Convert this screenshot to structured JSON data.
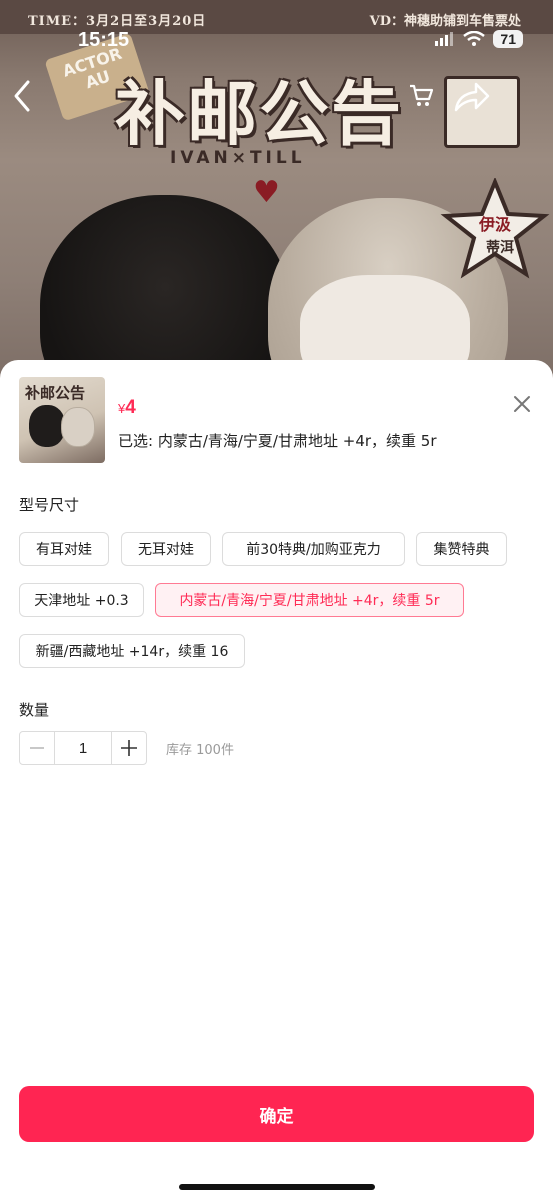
{
  "status_bar": {
    "time": "15:15",
    "battery": "71"
  },
  "banner": {
    "deco_left": "TIME：3月2日至3月20日",
    "deco_right": "VD：神穗助铺到车售票处",
    "title": "补邮公告",
    "subtitle": "IVAN×TILL",
    "badge": "ACTOR AU",
    "star_text": "伊汲 蒂洱"
  },
  "product": {
    "thumb_title": "补邮公告",
    "currency": "¥",
    "price": "4",
    "selected_text": "已选: 内蒙古/青海/宁夏/甘肃地址 +4r，续重 5r"
  },
  "spec": {
    "label": "型号尺寸",
    "options": [
      "有耳对娃",
      "无耳对娃",
      "前30特典/加购亚克力",
      "集赞特典",
      "天津地址 +0.3",
      "内蒙古/青海/宁夏/甘肃地址 +4r，续重 5r",
      "新疆/西藏地址 +14r，续重 16"
    ],
    "selected_index": 5
  },
  "quantity": {
    "label": "数量",
    "value": "1",
    "stock": "库存 100件"
  },
  "confirm_label": "确定",
  "colors": {
    "accent": "#ff2552",
    "price": "#ff2b55",
    "selected_bg": "#fff1f3",
    "selected_border": "#ff7a93"
  }
}
